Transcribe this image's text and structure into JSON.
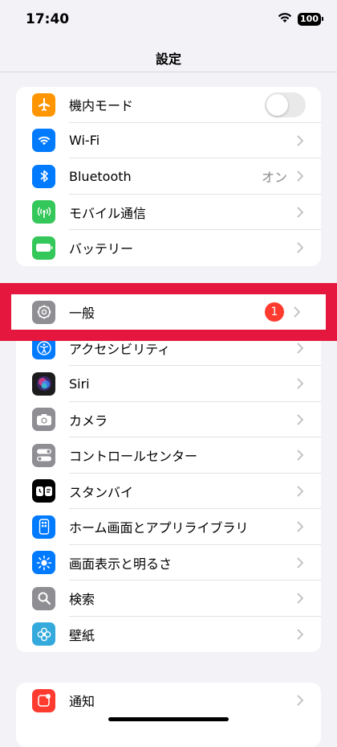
{
  "status_bar": {
    "time": "17:40",
    "battery": "100"
  },
  "nav": {
    "title": "設定"
  },
  "group1": [
    {
      "label": "機内モード",
      "icon": "airplane-icon",
      "color": "#ff9500",
      "toggle": false
    },
    {
      "label": "Wi-Fi",
      "icon": "wifi-icon",
      "color": "#007aff"
    },
    {
      "label": "Bluetooth",
      "icon": "bluetooth-icon",
      "color": "#007aff",
      "value": "オン"
    },
    {
      "label": "モバイル通信",
      "icon": "cellular-antenna-icon",
      "color": "#34c759"
    },
    {
      "label": "バッテリー",
      "icon": "battery-icon",
      "color": "#34c759"
    }
  ],
  "group2": [
    {
      "label": "一般",
      "icon": "gear-icon",
      "color": "#8e8e93",
      "badge": "1"
    },
    {
      "label": "アクセシビリティ",
      "icon": "accessibility-icon",
      "color": "#007aff"
    },
    {
      "label": "Siri",
      "icon": "siri-icon",
      "color": "#1c1c1e"
    },
    {
      "label": "カメラ",
      "icon": "camera-icon",
      "color": "#8e8e93"
    },
    {
      "label": "コントロールセンター",
      "icon": "control-center-icon",
      "color": "#8e8e93"
    },
    {
      "label": "スタンバイ",
      "icon": "standby-icon",
      "color": "#000000"
    },
    {
      "label": "ホーム画面とアプリライブラリ",
      "icon": "home-screen-icon",
      "color": "#007aff"
    },
    {
      "label": "画面表示と明るさ",
      "icon": "brightness-icon",
      "color": "#007aff"
    },
    {
      "label": "検索",
      "icon": "search-icon",
      "color": "#8e8e93"
    },
    {
      "label": "壁紙",
      "icon": "wallpaper-icon",
      "color": "#34aadc"
    }
  ],
  "group3": [
    {
      "label": "通知",
      "icon": "notification-icon",
      "color": "#ff3b30"
    }
  ],
  "accent_highlight": "#e5173f"
}
